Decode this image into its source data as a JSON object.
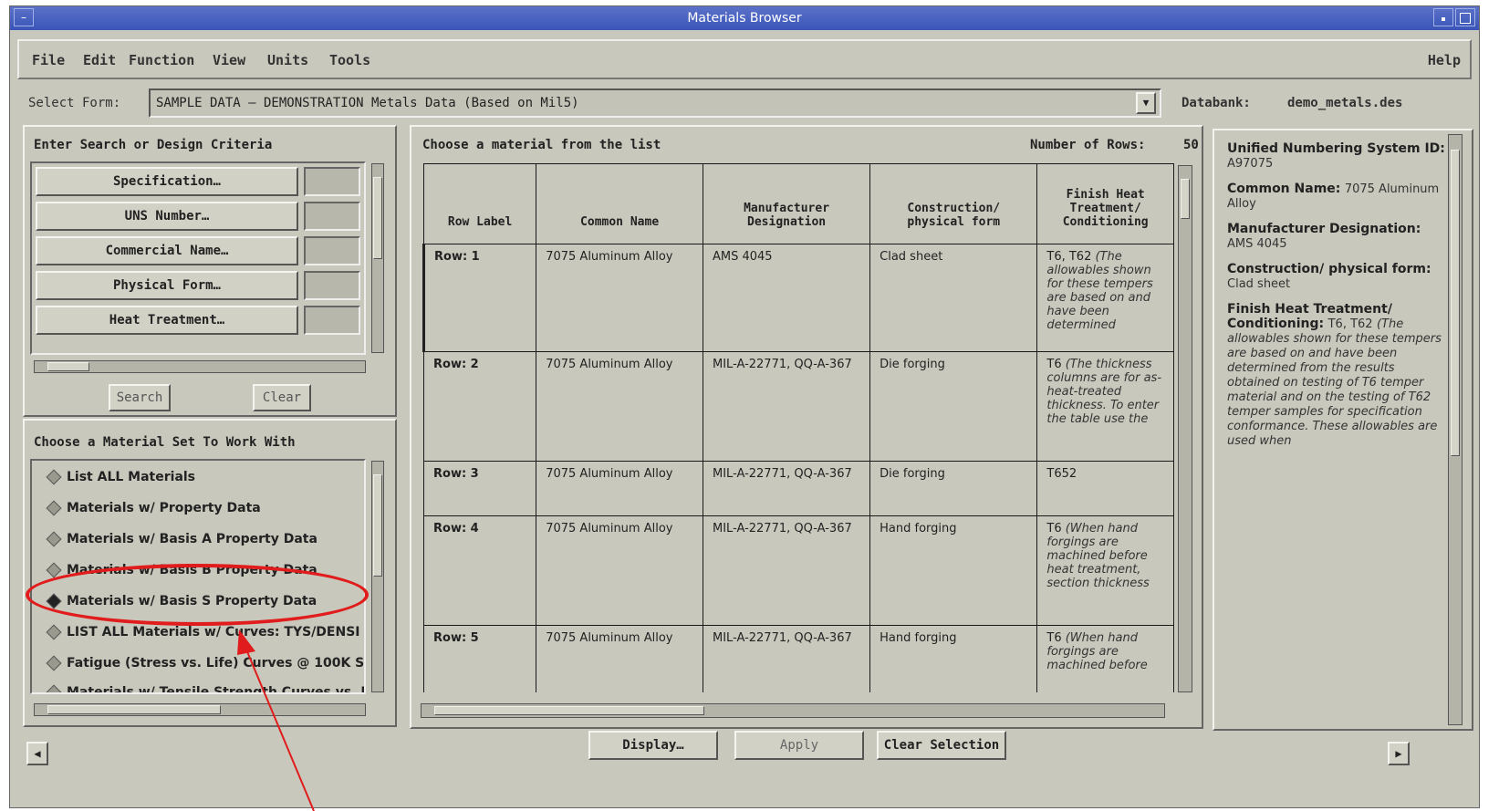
{
  "window": {
    "title": "Materials Browser",
    "menu_glyph": "–"
  },
  "menu": {
    "items": [
      "File",
      "Edit",
      "Function",
      "View",
      "Units",
      "Tools"
    ],
    "help": "Help"
  },
  "form_select": {
    "label": "Select Form:",
    "value": "SAMPLE DATA — DEMONSTRATION Metals Data (Based on Mil5)",
    "databank_label": "Databank:",
    "databank_value": "demo_metals.des"
  },
  "search_panel": {
    "title": "Enter Search or Design Criteria",
    "fields": [
      "Specification…",
      "UNS Number…",
      "Commercial Name…",
      "Physical Form…",
      "Heat Treatment…"
    ],
    "search_button": "Search",
    "clear_button": "Clear"
  },
  "material_set": {
    "title": "Choose a Material Set To Work With",
    "options": [
      "List ALL Materials",
      "Materials w/ Property Data",
      "Materials w/ Basis A Property Data",
      "Materials w/ Basis B Property Data",
      "Materials w/ Basis S Property Data",
      "LIST ALL Materials w/ Curves: TYS/DENSI",
      "Fatigue (Stress vs. Life) Curves @ 100K S",
      "Materials w/ Tensile Strength Curves vs. Pl"
    ],
    "selected_index": 4
  },
  "material_list": {
    "title": "Choose a material from the list",
    "rows_label": "Number of Rows:",
    "rows_value": "50",
    "columns": [
      "Row Label",
      "Common Name",
      "Manufacturer Designation",
      "Construction/ physical form",
      "Finish Heat Treatment/ Conditioning"
    ],
    "rows": [
      {
        "label": "Row: 1",
        "common": "7075 Aluminum Alloy",
        "manuf": "AMS 4045",
        "form": "Clad sheet",
        "treat_plain": "T6, T62",
        "treat_note": "(The allowables shown for these tempers are based on and have been determined"
      },
      {
        "label": "Row: 2",
        "common": "7075 Aluminum Alloy",
        "manuf": "MIL-A-22771, QQ-A-367",
        "form": "Die forging",
        "treat_plain": "T6",
        "treat_note": "(The thickness columns are for as-heat-treated thickness. To enter the table use the"
      },
      {
        "label": "Row: 3",
        "common": "7075 Aluminum Alloy",
        "manuf": "MIL-A-22771, QQ-A-367",
        "form": "Die forging",
        "treat_plain": "T652",
        "treat_note": ""
      },
      {
        "label": "Row: 4",
        "common": "7075 Aluminum Alloy",
        "manuf": "MIL-A-22771, QQ-A-367",
        "form": "Hand forging",
        "treat_plain": "T6",
        "treat_note": "(When hand forgings are machined before heat treatment, section thickness"
      },
      {
        "label": "Row: 5",
        "common": "7075 Aluminum Alloy",
        "manuf": "MIL-A-22771, QQ-A-367",
        "form": "Hand forging",
        "treat_plain": "T6",
        "treat_note": "(When hand forgings are machined before"
      }
    ]
  },
  "details": {
    "uns_label": "Unified Numbering System ID:",
    "uns_value": "A97075",
    "common_label": "Common Name:",
    "common_value": "7075 Aluminum Alloy",
    "manuf_label": "Manufacturer Designation:",
    "manuf_value": "AMS 4045",
    "form_label": "Construction/ physical form:",
    "form_value": "Clad sheet",
    "treat_label": "Finish Heat Treatment/ Conditioning:",
    "treat_value": "T6, T62",
    "treat_note": "(The allowables shown for these tempers are based on and have been determined from the results obtained on testing of T6 temper material and on the testing of T62 temper samples for specification conformance. These allowables are used when"
  },
  "bottom_bar": {
    "display_button": "Display…",
    "apply_button": "Apply",
    "clear_selection_button": "Clear Selection"
  },
  "colors": {
    "annotation": "#e01c1c",
    "titlebar": "#3a55b8",
    "chrome": "#c9c8bd"
  }
}
